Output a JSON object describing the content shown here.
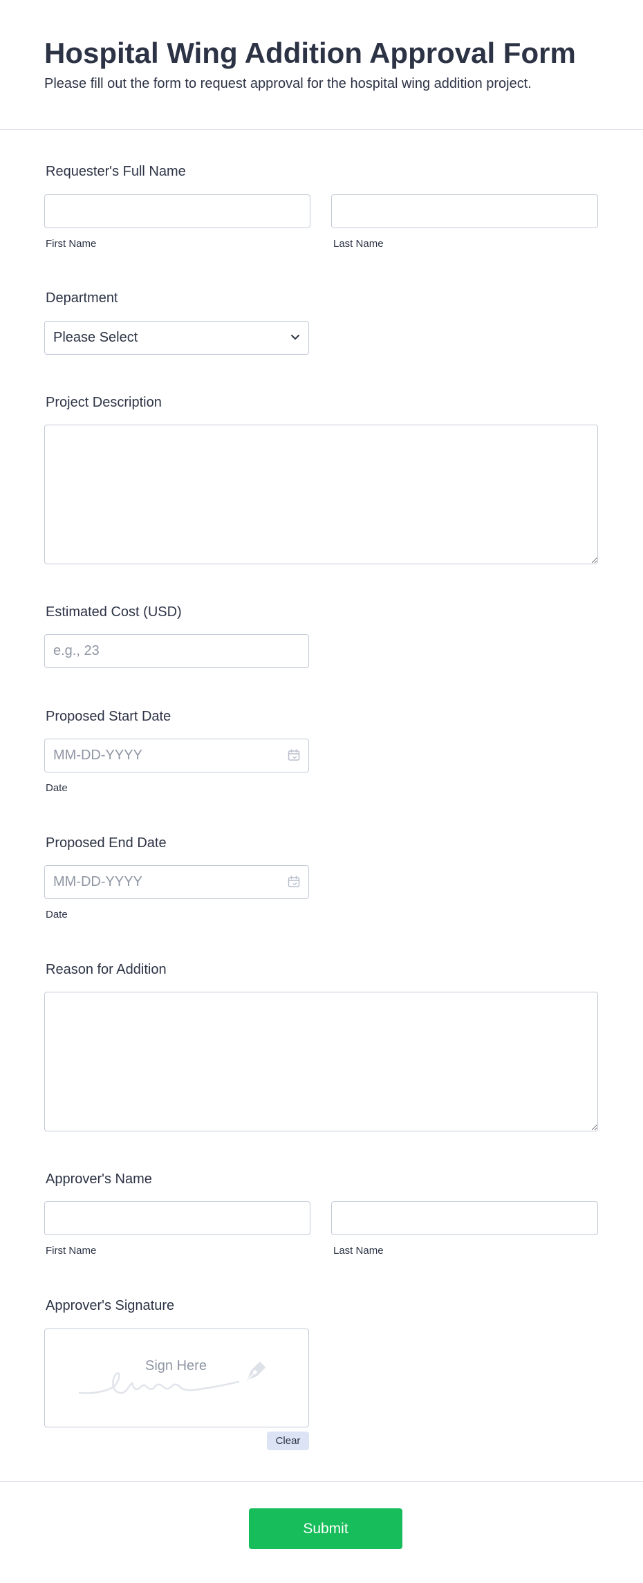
{
  "header": {
    "title": "Hospital Wing Addition Approval Form",
    "subtitle": "Please fill out the form to request approval for the hospital wing addition project."
  },
  "requester": {
    "label": "Requester's Full Name",
    "first_value": "",
    "last_value": "",
    "first_sublabel": "First Name",
    "last_sublabel": "Last Name"
  },
  "department": {
    "label": "Department",
    "selected": "Please Select"
  },
  "project_description": {
    "label": "Project Description",
    "value": ""
  },
  "estimated_cost": {
    "label": "Estimated Cost (USD)",
    "placeholder": "e.g., 23",
    "value": ""
  },
  "start_date": {
    "label": "Proposed Start Date",
    "placeholder": "MM-DD-YYYY",
    "sublabel": "Date"
  },
  "end_date": {
    "label": "Proposed End Date",
    "placeholder": "MM-DD-YYYY",
    "sublabel": "Date"
  },
  "reason": {
    "label": "Reason for Addition",
    "value": ""
  },
  "approver": {
    "label": "Approver's Name",
    "first_sublabel": "First Name",
    "last_sublabel": "Last Name"
  },
  "signature": {
    "label": "Approver's Signature",
    "placeholder_text": "Sign Here",
    "clear_label": "Clear"
  },
  "submit": {
    "label": "Submit"
  },
  "colors": {
    "text": "#2c3345",
    "border": "#c3cad8",
    "placeholder": "#8f96a3",
    "submit_bg": "#18bd5b",
    "clear_bg": "#dbe3f5"
  },
  "icons": {
    "department_chevron": "chevron-down-icon",
    "date_picker": "calendar-icon",
    "signature": "pen-nib-icon"
  }
}
